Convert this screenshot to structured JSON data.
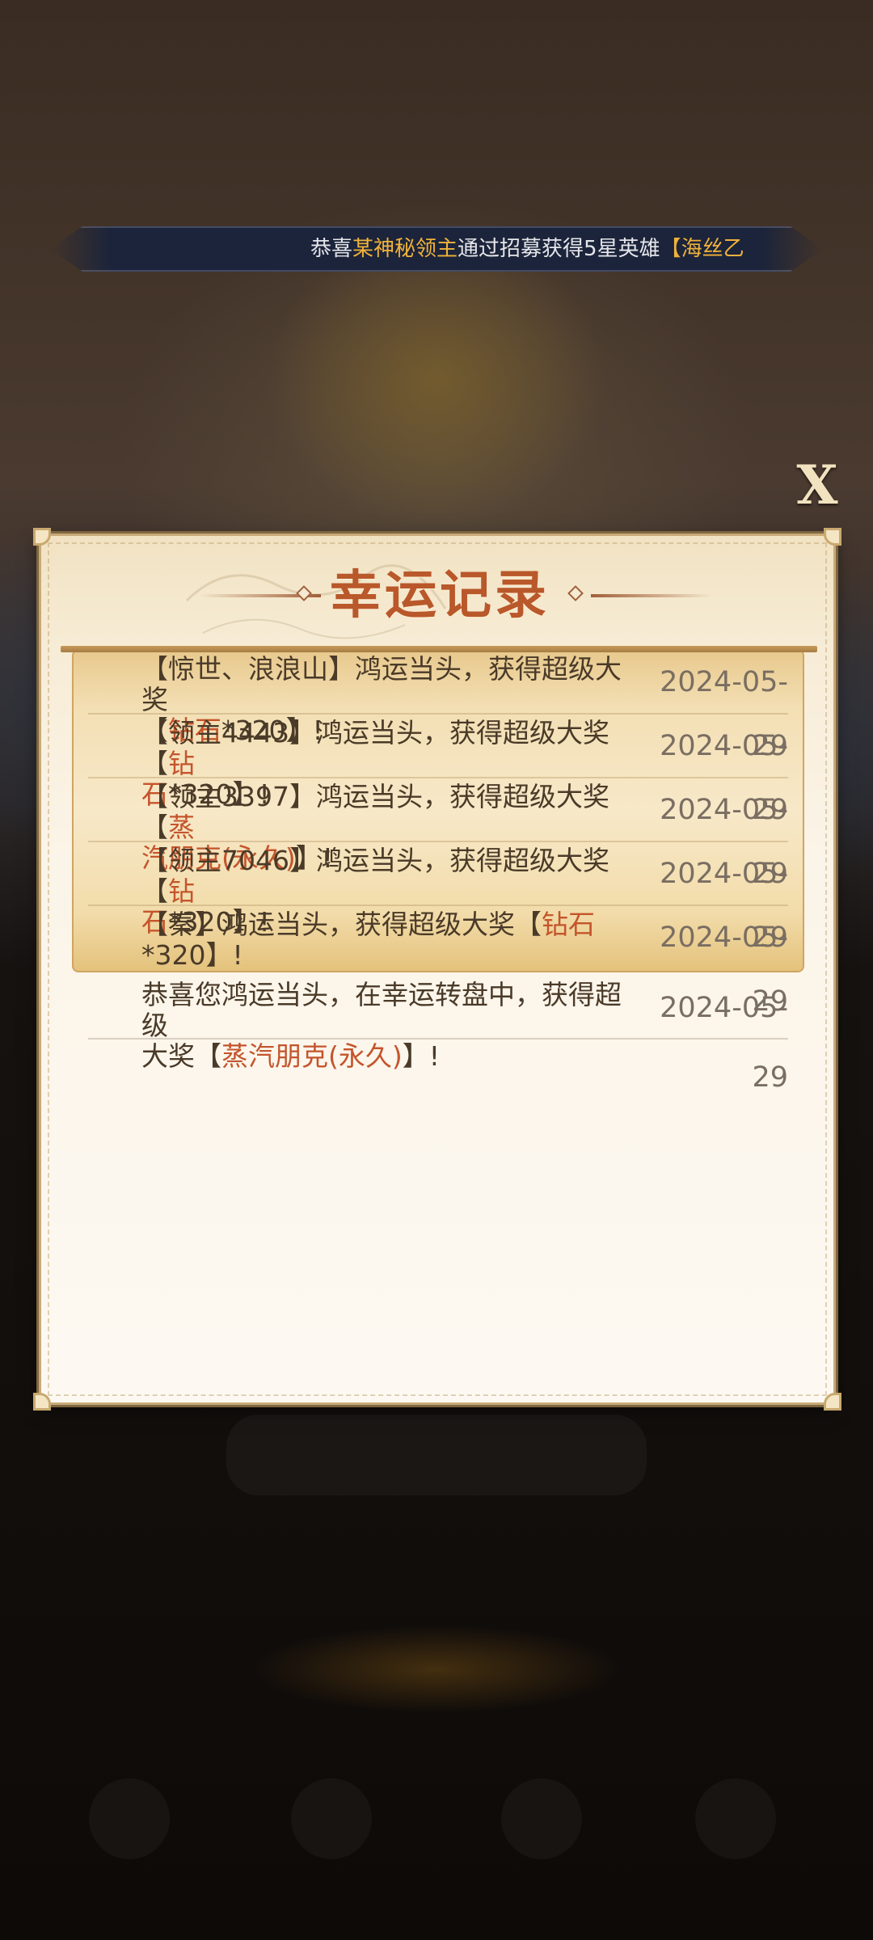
{
  "marquee": {
    "prefix": "恭喜",
    "player": "某神秘领主",
    "middle": "通过招募获得5星英雄",
    "hero": "【海丝乙"
  },
  "dialog": {
    "title": "幸运记录",
    "close_label": "X"
  },
  "records": [
    {
      "line1": "【惊世、浪浪山】鸿运当头，获得超级大奖",
      "line2_pre": "【",
      "prize": "钻石",
      "line2_post": "*320】!",
      "date": "2024-05-29"
    },
    {
      "line1_pre": "【领主4443】鸿运当头，获得超级大奖【",
      "prize_a": "钻",
      "prize_b": "石",
      "line2_post": "*320】!",
      "date": "2024-05-29"
    },
    {
      "line1_pre": "【领主3397】鸿运当头，获得超级大奖【",
      "prize_a": "蒸",
      "prize_b": "汽朋克(永久)",
      "line2_post": "】!",
      "date": "2024-05-29"
    },
    {
      "line1_pre": "【领主7046】鸿运当头，获得超级大奖【",
      "prize_a": "钻",
      "prize_b": "石",
      "line2_post": "*320】!",
      "date": "2024-05-29"
    },
    {
      "line1_pre": "【秦】鸿运当头，获得超级大奖【",
      "prize": "钻石",
      "line2": "*320】!",
      "date": "2024-05-29"
    },
    {
      "line1": "恭喜您鸿运当头，在幸运转盘中，获得超级",
      "line2_pre": "大奖【",
      "prize": "蒸汽朋克(永久)",
      "line2_post": "】!",
      "date": "2024-05-29"
    }
  ]
}
